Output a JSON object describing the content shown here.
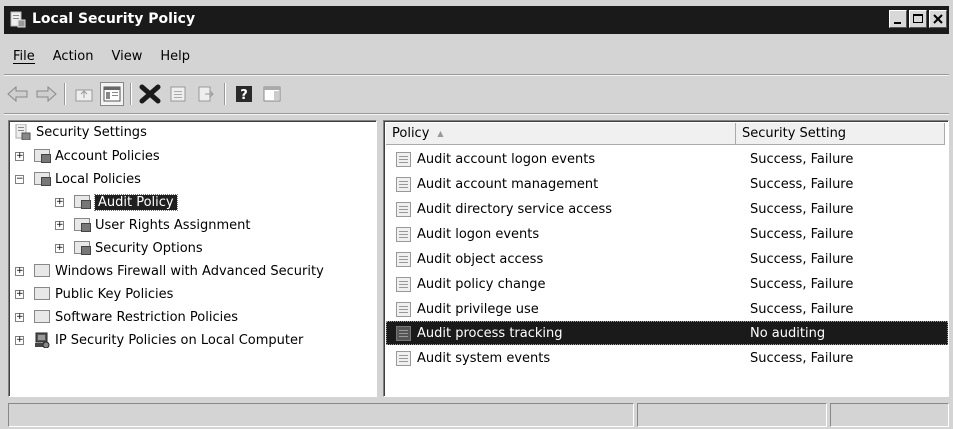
{
  "window": {
    "title": "Local Security Policy"
  },
  "menu": [
    "File",
    "Action",
    "View",
    "Help"
  ],
  "menu_accel": [
    "F",
    "A",
    "V",
    "H"
  ],
  "toolbar": [
    "back-arrow-icon",
    "forward-arrow-icon",
    "up-folder-icon",
    "show-hide-tree-icon",
    "delete-icon",
    "properties-icon",
    "export-list-icon",
    "help-icon",
    "show-hide-action-pane-icon"
  ],
  "tree": {
    "root": "Security Settings",
    "items": [
      {
        "label": "Account Policies"
      },
      {
        "label": "Local Policies"
      },
      {
        "label": "Audit Policy"
      },
      {
        "label": "User Rights Assignment"
      },
      {
        "label": "Security Options"
      },
      {
        "label": "Windows Firewall with Advanced Security"
      },
      {
        "label": "Public Key Policies"
      },
      {
        "label": "Software Restriction Policies"
      },
      {
        "label": "IP Security Policies on Local Computer"
      }
    ]
  },
  "list": {
    "columns": [
      "Policy",
      "Security Setting"
    ],
    "sort_indicator": "▲",
    "rows": [
      {
        "policy": "Audit account logon events",
        "setting": "Success, Failure"
      },
      {
        "policy": "Audit account management",
        "setting": "Success, Failure"
      },
      {
        "policy": "Audit directory service access",
        "setting": "Success, Failure"
      },
      {
        "policy": "Audit logon events",
        "setting": "Success, Failure"
      },
      {
        "policy": "Audit object access",
        "setting": "Success, Failure"
      },
      {
        "policy": "Audit policy change",
        "setting": "Success, Failure"
      },
      {
        "policy": "Audit privilege use",
        "setting": "Success, Failure"
      },
      {
        "policy": "Audit process tracking",
        "setting": "No auditing"
      },
      {
        "policy": "Audit system events",
        "setting": "Success, Failure"
      }
    ]
  },
  "colors": {
    "titlebar": "#1a1a1a",
    "selection": "#1a1a1a",
    "chrome": "#d4d4d4"
  }
}
